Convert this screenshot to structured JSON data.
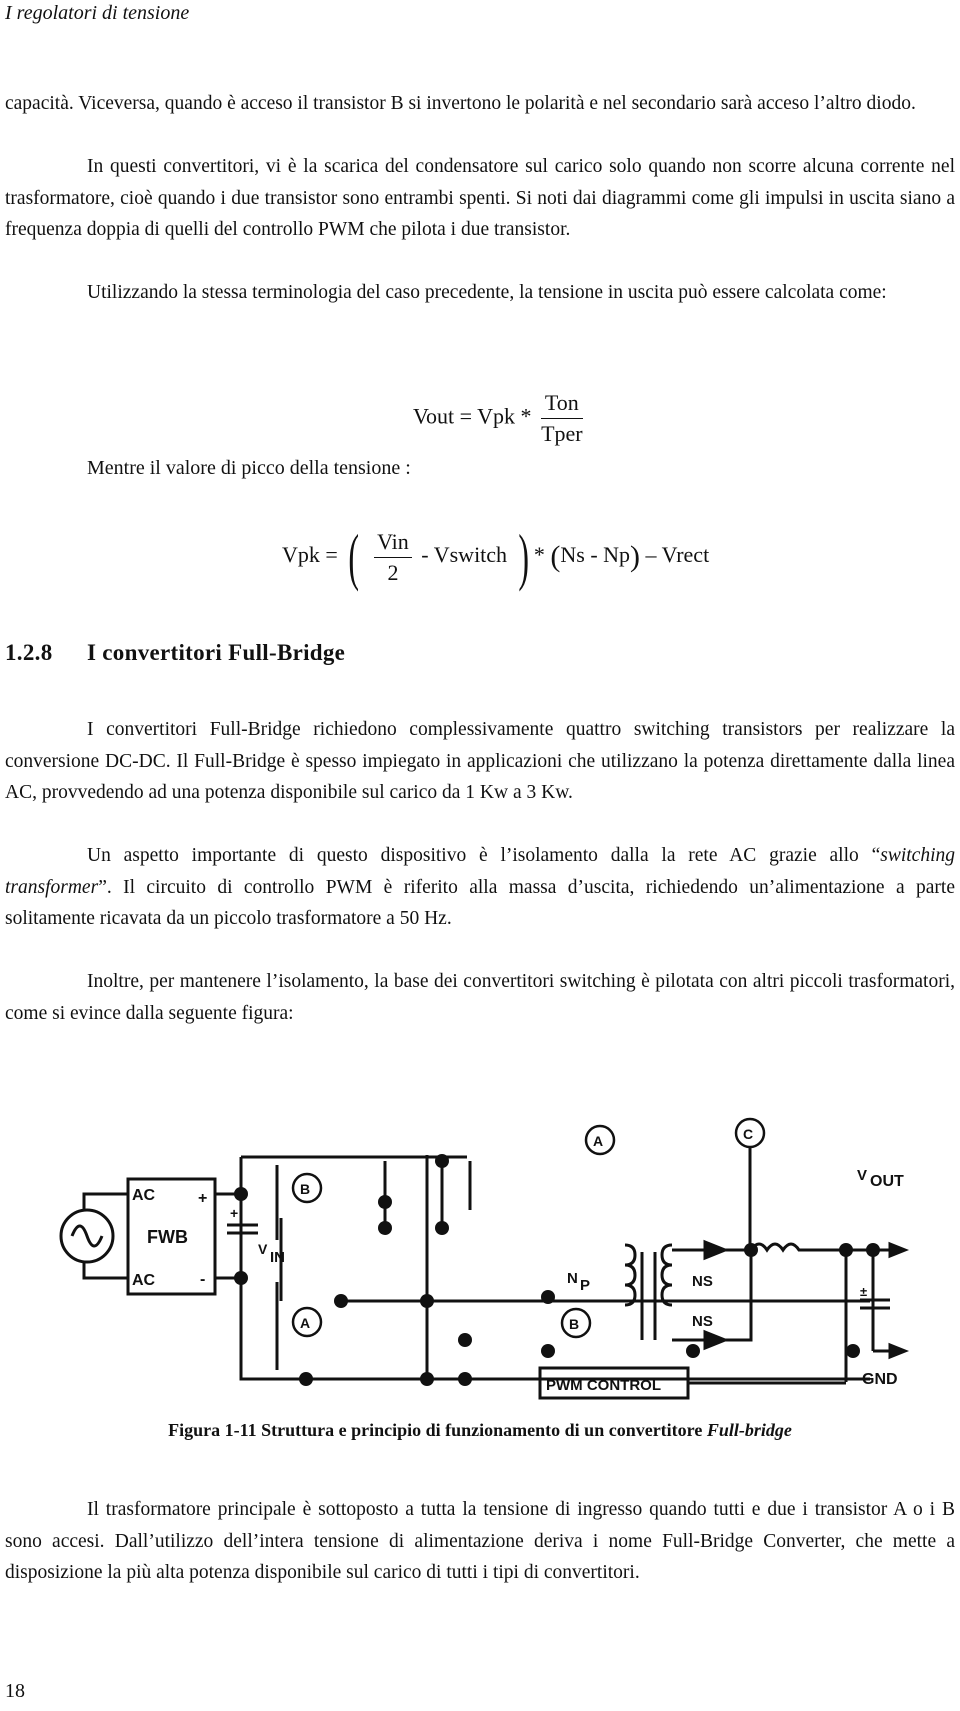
{
  "header": {
    "running_title": "I regolatori di tensione"
  },
  "paragraphs_top": [
    {
      "id": "p1",
      "indent": false,
      "text": "capacità. Viceversa, quando è acceso il transistor B si invertono le polarità e nel secondario sarà acceso l’altro diodo."
    },
    {
      "id": "p2",
      "indent": true,
      "text": "In questi convertitori, vi è la scarica del condensatore sul carico solo quando non scorre alcuna corrente nel trasformatore, cioè quando i due transistor sono entrambi spenti. Si noti dai diagrammi come gli impulsi in uscita siano a frequenza doppia di quelli del controllo PWM che pilota i due transistor."
    },
    {
      "id": "p3",
      "indent": true,
      "text": "Utilizzando la stessa terminologia del caso precedente, la tensione in uscita può essere calcolata come:"
    }
  ],
  "equation1": {
    "lhs": "Vout = Vpk *",
    "numerator": "Ton",
    "denominator": "Tper"
  },
  "mid_text": "Mentre il valore di picco della tensione :",
  "equation2": {
    "lhs": "Vpk =",
    "numerator": "Vin",
    "denominator": "2",
    "minus_term": "- Vswitch",
    "times": "*",
    "group": "Ns - Np",
    "tail": "– Vrect"
  },
  "section": {
    "number": "1.2.8",
    "title": "I convertitori Full-Bridge"
  },
  "paragraphs_section": [
    {
      "id": "p4",
      "indent": true,
      "text": "I convertitori Full-Bridge richiedono complessivamente quattro switching transistors per realizzare la conversione DC-DC. Il Full-Bridge è spesso impiegato in applicazioni che utilizzano la potenza direttamente dalla linea AC, provvedendo ad una potenza disponibile sul carico da 1 Kw a 3 Kw."
    },
    {
      "id": "p5",
      "indent": true,
      "text_before": "Un aspetto importante di questo dispositivo è l’isolamento dalla la rete AC grazie allo “",
      "italic": "switching transformer",
      "text_after": "”. Il circuito di controllo PWM è riferito alla massa d’uscita, richiedendo un’alimentazione a parte solitamente ricavata da un piccolo trasformatore a 50 Hz."
    },
    {
      "id": "p6",
      "indent": true,
      "text": "Inoltre, per mantenere l’isolamento, la base dei convertitori switching è pilotata con altri piccoli trasformatori, come si evince dalla seguente figura:"
    }
  ],
  "figure": {
    "labels": {
      "ac_top": "AC",
      "ac_bottom": "AC",
      "fwb": "FWB",
      "plus": "+",
      "minus": "-",
      "cap_plus": "+",
      "vin_v": "V",
      "vin_sub": "IN",
      "node_a": "A",
      "node_b": "B",
      "node_c": "C",
      "np_n": "N",
      "np_sub": "P",
      "ns1": "NS",
      "ns2": "NS",
      "vout_v": "V",
      "vout_sub": "OUT",
      "out_cap_plus": "±",
      "pwm": "PWM CONTROL",
      "gnd": "GND"
    },
    "caption_bold": "Figura 1-11 Struttura e principio di funzionamento di un convertitore ",
    "caption_italic": "Full-bridge"
  },
  "paragraphs_bottom": [
    {
      "id": "p7",
      "indent": true,
      "text": "Il trasformatore principale è sottoposto a tutta la tensione di ingresso quando tutti e due i transistor A o i B sono accesi. Dall’utilizzo dell’intera tensione di alimentazione deriva i nome Full-Bridge Converter, che mette a disposizione la più alta potenza disponibile sul carico di tutti i tipi di convertitori."
    }
  ],
  "footer": {
    "page_number": "18"
  }
}
